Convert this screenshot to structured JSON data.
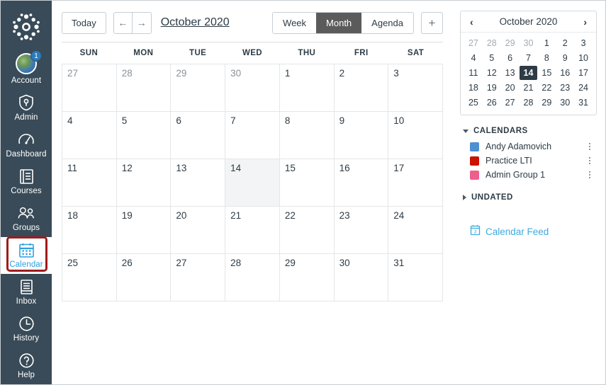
{
  "globalnav": {
    "logo_icon": "canvas-logo-icon",
    "items": [
      {
        "label": "Account",
        "icon": "avatar-icon",
        "badge": "1",
        "active": false
      },
      {
        "label": "Admin",
        "icon": "shield-icon",
        "badge": null,
        "active": false
      },
      {
        "label": "Dashboard",
        "icon": "dashboard-icon",
        "badge": null,
        "active": false
      },
      {
        "label": "Courses",
        "icon": "book-icon",
        "badge": null,
        "active": false
      },
      {
        "label": "Groups",
        "icon": "groups-icon",
        "badge": null,
        "active": false
      },
      {
        "label": "Calendar",
        "icon": "calendar-icon",
        "badge": null,
        "active": true
      },
      {
        "label": "Inbox",
        "icon": "inbox-icon",
        "badge": null,
        "active": false
      },
      {
        "label": "History",
        "icon": "clock-icon",
        "badge": null,
        "active": false
      },
      {
        "label": "Help",
        "icon": "question-circle-icon",
        "badge": null,
        "active": false
      }
    ]
  },
  "toolbar": {
    "today_label": "Today",
    "prev_label": "←",
    "next_label": "→",
    "month_title": "October 2020",
    "views": [
      {
        "label": "Week",
        "selected": false
      },
      {
        "label": "Month",
        "selected": true
      },
      {
        "label": "Agenda",
        "selected": false
      }
    ],
    "add_label": "+"
  },
  "calendar": {
    "day_headers": [
      "SUN",
      "MON",
      "TUE",
      "WED",
      "THU",
      "FRI",
      "SAT"
    ],
    "weeks": [
      [
        {
          "num": "27",
          "other": true,
          "today": false
        },
        {
          "num": "28",
          "other": true,
          "today": false
        },
        {
          "num": "29",
          "other": true,
          "today": false
        },
        {
          "num": "30",
          "other": true,
          "today": false
        },
        {
          "num": "1",
          "other": false,
          "today": false
        },
        {
          "num": "2",
          "other": false,
          "today": false
        },
        {
          "num": "3",
          "other": false,
          "today": false
        }
      ],
      [
        {
          "num": "4",
          "other": false,
          "today": false
        },
        {
          "num": "5",
          "other": false,
          "today": false
        },
        {
          "num": "6",
          "other": false,
          "today": false
        },
        {
          "num": "7",
          "other": false,
          "today": false
        },
        {
          "num": "8",
          "other": false,
          "today": false
        },
        {
          "num": "9",
          "other": false,
          "today": false
        },
        {
          "num": "10",
          "other": false,
          "today": false
        }
      ],
      [
        {
          "num": "11",
          "other": false,
          "today": false
        },
        {
          "num": "12",
          "other": false,
          "today": false
        },
        {
          "num": "13",
          "other": false,
          "today": false
        },
        {
          "num": "14",
          "other": false,
          "today": true
        },
        {
          "num": "15",
          "other": false,
          "today": false
        },
        {
          "num": "16",
          "other": false,
          "today": false
        },
        {
          "num": "17",
          "other": false,
          "today": false
        }
      ],
      [
        {
          "num": "18",
          "other": false,
          "today": false
        },
        {
          "num": "19",
          "other": false,
          "today": false
        },
        {
          "num": "20",
          "other": false,
          "today": false
        },
        {
          "num": "21",
          "other": false,
          "today": false
        },
        {
          "num": "22",
          "other": false,
          "today": false
        },
        {
          "num": "23",
          "other": false,
          "today": false
        },
        {
          "num": "24",
          "other": false,
          "today": false
        }
      ],
      [
        {
          "num": "25",
          "other": false,
          "today": false
        },
        {
          "num": "26",
          "other": false,
          "today": false
        },
        {
          "num": "27",
          "other": false,
          "today": false
        },
        {
          "num": "28",
          "other": false,
          "today": false
        },
        {
          "num": "29",
          "other": false,
          "today": false
        },
        {
          "num": "30",
          "other": false,
          "today": false
        },
        {
          "num": "31",
          "other": false,
          "today": false
        }
      ]
    ]
  },
  "minicalendar": {
    "prev_label": "‹",
    "title": "October 2020",
    "next_label": "›",
    "days": [
      {
        "num": "27",
        "other": true,
        "selected": false
      },
      {
        "num": "28",
        "other": true,
        "selected": false
      },
      {
        "num": "29",
        "other": true,
        "selected": false
      },
      {
        "num": "30",
        "other": true,
        "selected": false
      },
      {
        "num": "1",
        "other": false,
        "selected": false
      },
      {
        "num": "2",
        "other": false,
        "selected": false
      },
      {
        "num": "3",
        "other": false,
        "selected": false
      },
      {
        "num": "4",
        "other": false,
        "selected": false
      },
      {
        "num": "5",
        "other": false,
        "selected": false
      },
      {
        "num": "6",
        "other": false,
        "selected": false
      },
      {
        "num": "7",
        "other": false,
        "selected": false
      },
      {
        "num": "8",
        "other": false,
        "selected": false
      },
      {
        "num": "9",
        "other": false,
        "selected": false
      },
      {
        "num": "10",
        "other": false,
        "selected": false
      },
      {
        "num": "11",
        "other": false,
        "selected": false
      },
      {
        "num": "12",
        "other": false,
        "selected": false
      },
      {
        "num": "13",
        "other": false,
        "selected": false
      },
      {
        "num": "14",
        "other": false,
        "selected": true
      },
      {
        "num": "15",
        "other": false,
        "selected": false
      },
      {
        "num": "16",
        "other": false,
        "selected": false
      },
      {
        "num": "17",
        "other": false,
        "selected": false
      },
      {
        "num": "18",
        "other": false,
        "selected": false
      },
      {
        "num": "19",
        "other": false,
        "selected": false
      },
      {
        "num": "20",
        "other": false,
        "selected": false
      },
      {
        "num": "21",
        "other": false,
        "selected": false
      },
      {
        "num": "22",
        "other": false,
        "selected": false
      },
      {
        "num": "23",
        "other": false,
        "selected": false
      },
      {
        "num": "24",
        "other": false,
        "selected": false
      },
      {
        "num": "25",
        "other": false,
        "selected": false
      },
      {
        "num": "26",
        "other": false,
        "selected": false
      },
      {
        "num": "27",
        "other": false,
        "selected": false
      },
      {
        "num": "28",
        "other": false,
        "selected": false
      },
      {
        "num": "29",
        "other": false,
        "selected": false
      },
      {
        "num": "30",
        "other": false,
        "selected": false
      },
      {
        "num": "31",
        "other": false,
        "selected": false
      }
    ]
  },
  "calendars_section": {
    "title": "CALENDARS",
    "expanded": true,
    "items": [
      {
        "name": "Andy Adamovich",
        "color": "#4d8fd1"
      },
      {
        "name": "Practice LTI",
        "color": "#cc1100"
      },
      {
        "name": "Admin Group 1",
        "color": "#ee5e8f"
      }
    ]
  },
  "undated_section": {
    "title": "UNDATED",
    "expanded": false
  },
  "calendar_feed": {
    "label": "Calendar Feed",
    "icon": "calendar-feed-icon",
    "color": "#3eaadf"
  },
  "colors": {
    "nav_bg": "#394b58",
    "accent": "#3eaadf",
    "selected_view_bg": "#5b5b5b",
    "today_cell_bg": "#f3f4f5",
    "mini_selected_bg": "#2d3b45",
    "annotation_border": "#9f1c1c"
  }
}
